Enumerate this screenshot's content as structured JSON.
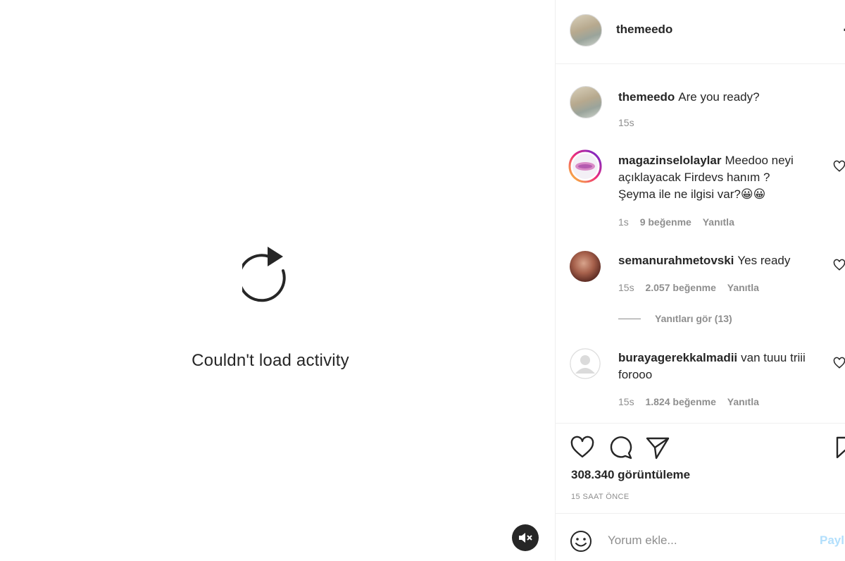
{
  "media": {
    "error_text": "Couldn't load activity",
    "reload_icon": "reload-icon",
    "mute_icon": "speaker-muted-icon"
  },
  "header": {
    "username": "themeedo",
    "more_icon": "more-options-icon"
  },
  "caption": {
    "username": "themeedo",
    "text": "Are you ready?",
    "time": "15s"
  },
  "comments": [
    {
      "username": "magazinselolaylar",
      "text": "Meedoo neyi açıklayacak Firdevs hanım ? Şeyma ile ne ilgisi var?😀😀",
      "time": "1s",
      "likes": "9 beğenme",
      "reply": "Yanıtla"
    },
    {
      "username": "semanurahmetovski",
      "text": "Yes ready",
      "time": "15s",
      "likes": "2.057 beğenme",
      "reply": "Yanıtla"
    },
    {
      "username": "burayagerekkalmadii",
      "text": "van tuuu triii forooo",
      "time": "15s",
      "likes": "1.824 beğenme",
      "reply": "Yanıtla"
    }
  ],
  "view_replies": "Yanıtları gör (13)",
  "actions": {
    "views": "308.340 görüntüleme",
    "timestamp": "15 SAAT ÖNCE"
  },
  "add_comment": {
    "placeholder": "Yorum ekle...",
    "post_label": "Payl"
  },
  "colors": {
    "text": "#262626",
    "secondary": "#8e8e8e",
    "divider": "#efefef",
    "post_disabled": "#b2dffc"
  }
}
